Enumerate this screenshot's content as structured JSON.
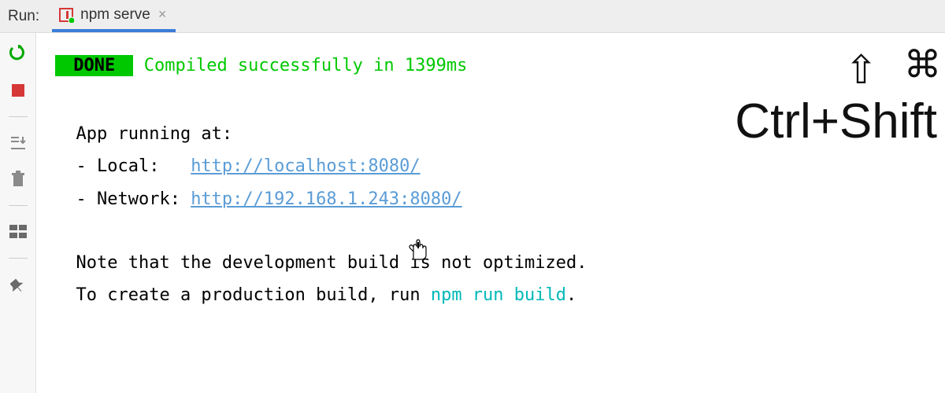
{
  "header": {
    "run_label": "Run:",
    "tab_title": "npm serve"
  },
  "console": {
    "done_badge": " DONE ",
    "compiled_msg": " Compiled successfully in 1399ms",
    "app_running_label": "  App running at:",
    "local_label": "  - Local:   ",
    "local_url": "http://localhost:8080/",
    "network_label": "  - Network: ",
    "network_url": "http://192.168.1.243:8080/",
    "note_line1": "  Note that the development build is not optimized.",
    "note_line2a": "  To create a production build, run ",
    "note_command": "npm run build",
    "note_line2b": "."
  },
  "overlay": {
    "symbols": "⇧ ⌘",
    "text": "Ctrl+Shift"
  }
}
